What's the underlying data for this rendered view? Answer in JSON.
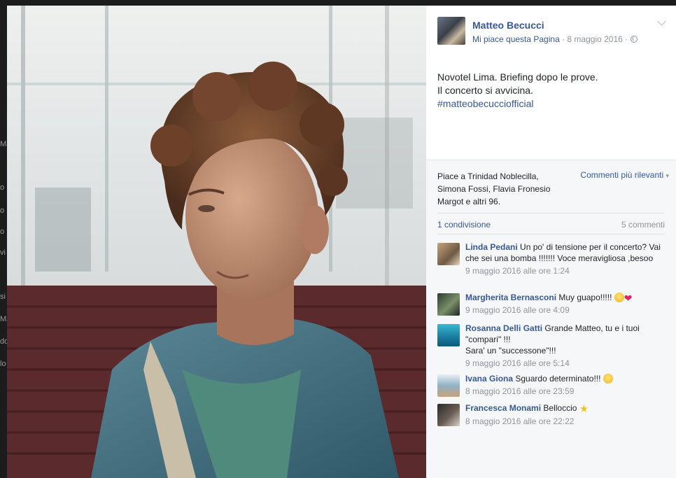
{
  "post": {
    "page_name": "Matteo Becucci",
    "like_page_label": "Mi piace questa Pagina",
    "separator": " · ",
    "date": "8 maggio 2016",
    "text_lines": [
      "Novotel Lima. Briefing dopo le prove.",
      "Il concerto si avvicina."
    ],
    "hashtag": "#matteobecucciofficial"
  },
  "engagement": {
    "likes_text": "Piace a Trinidad Noblecilla, Simona Fossi, Flavia Fronesio Margot e altri 96.",
    "sort_label": "Commenti più rilevanti",
    "sort_caret": "▾",
    "shares": "1 condivisione",
    "comments_count": "5 commenti"
  },
  "comments": [
    {
      "author": "Linda Pedani",
      "text": "Un po' di tensione per il concerto? Vai che sei una bomba !!!!!!! Voce meravigliosa ,besoo",
      "time": "9 maggio 2016 alle ore 1:24"
    },
    {
      "author": "Margherita Bernasconi",
      "text": "Muy guapo!!!!! ",
      "time": "9 maggio 2016 alle ore 4:09"
    },
    {
      "author": "Rosanna Delli Gatti",
      "text": "Grande Matteo, tu e i tuoi \"compari\" !!!",
      "text2": "Sara' un \"successone\"!!!",
      "time": "9 maggio 2016 alle ore 5:14"
    },
    {
      "author": "Ivana Giona",
      "text": "Sguardo determinato!!! ",
      "time": "8 maggio 2016 alle ore 23:59"
    },
    {
      "author": "Francesca Monami",
      "text": "Belloccio ",
      "time": "8 maggio 2016 alle ore 22:22"
    }
  ],
  "emojis": {
    "heart": "❤",
    "star": "★"
  },
  "background_fragments": [
    "Ma",
    "o",
    "o",
    "o",
    "vi",
    "si",
    "Ma",
    "do",
    "lo"
  ]
}
